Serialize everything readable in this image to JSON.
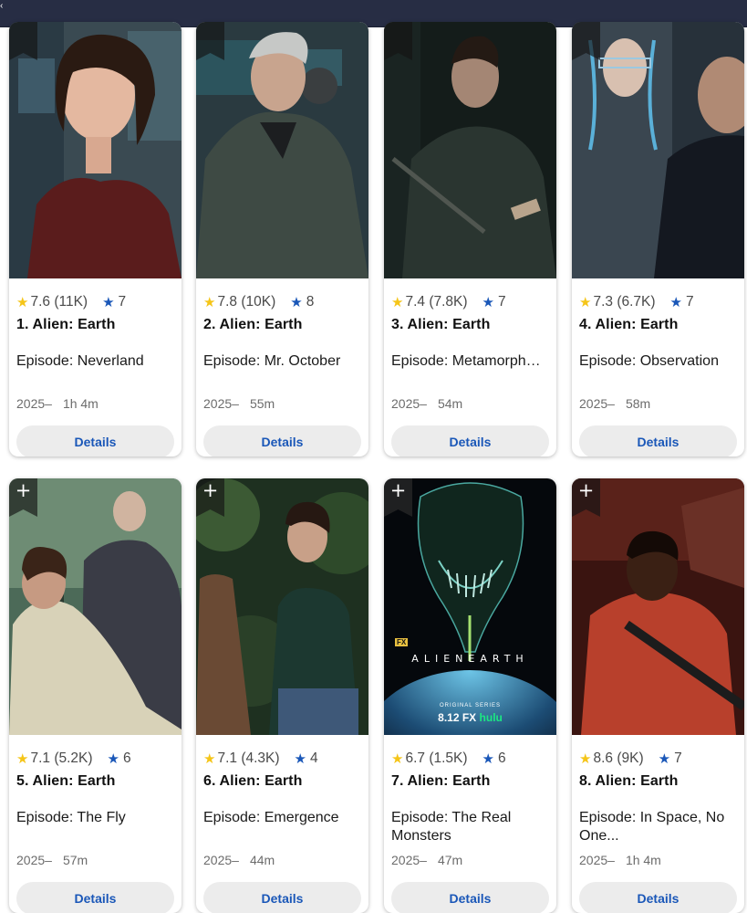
{
  "topbar": {
    "glyph": "‹"
  },
  "details_label": "Details",
  "colors": {
    "rating_star": "#f5c518",
    "user_star": "#1a57b8",
    "button_text": "#1a57b8",
    "button_bg": "#ececec",
    "topbar": "#272d44"
  },
  "cards": [
    {
      "rating": "7.6",
      "votes": "(11K)",
      "user_rating": "7",
      "title": "1. Alien: Earth",
      "episode": "Episode: Neverland",
      "year": "2025–",
      "runtime": "1h 4m"
    },
    {
      "rating": "7.8",
      "votes": "(10K)",
      "user_rating": "8",
      "title": "2. Alien: Earth",
      "episode": "Episode: Mr. October",
      "year": "2025–",
      "runtime": "55m"
    },
    {
      "rating": "7.4",
      "votes": "(7.8K)",
      "user_rating": "7",
      "title": "3. Alien: Earth",
      "episode": "Episode: Metamorph…",
      "year": "2025–",
      "runtime": "54m"
    },
    {
      "rating": "7.3",
      "votes": "(6.7K)",
      "user_rating": "7",
      "title": "4. Alien: Earth",
      "episode": "Episode: Observation",
      "year": "2025–",
      "runtime": "58m"
    },
    {
      "rating": "7.1",
      "votes": "(5.2K)",
      "user_rating": "6",
      "title": "5. Alien: Earth",
      "episode": "Episode: The Fly",
      "year": "2025–",
      "runtime": "57m"
    },
    {
      "rating": "7.1",
      "votes": "(4.3K)",
      "user_rating": "4",
      "title": "6. Alien: Earth",
      "episode": "Episode: Emergence",
      "year": "2025–",
      "runtime": "44m"
    },
    {
      "rating": "6.7",
      "votes": "(1.5K)",
      "user_rating": "6",
      "title": "7. Alien: Earth",
      "episode": "Episode: The Real Monsters",
      "year": "2025–",
      "runtime": "47m"
    },
    {
      "rating": "8.6",
      "votes": "(9K)",
      "user_rating": "7",
      "title": "8. Alien: Earth",
      "episode": "Episode: In Space, No One...",
      "year": "2025–",
      "runtime": "1h 4m"
    }
  ],
  "poster7": {
    "fx_badge": "FX",
    "logo_text": "ALIENEARTH",
    "series_label": "ORIGINAL SERIES",
    "premiere": "8.12",
    "fx_small": "FX",
    "hulu": "hulu"
  }
}
